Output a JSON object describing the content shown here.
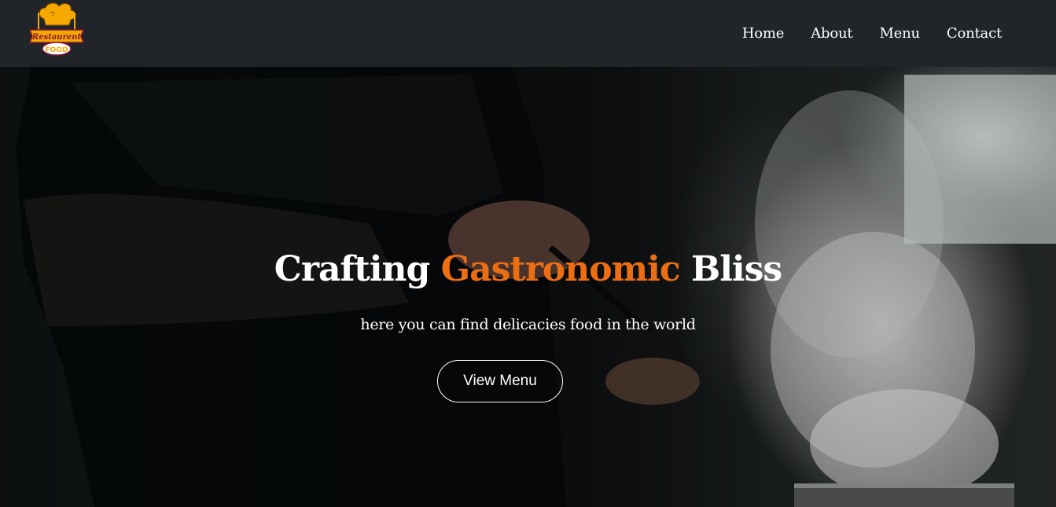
{
  "nav": {
    "logo": {
      "top_text": "Restaurent",
      "bottom_text": "FOOD",
      "icon": "chef-hat-logo"
    },
    "links": [
      {
        "label": "Home"
      },
      {
        "label": "About"
      },
      {
        "label": "Menu"
      },
      {
        "label": "Contact"
      }
    ]
  },
  "hero": {
    "title_part1": "Crafting",
    "title_accent": "Gastronomic",
    "title_part2": "Bliss",
    "subtitle": "here you can find delicacies food in the world",
    "button_label": "View Menu"
  },
  "colors": {
    "navbar_bg": "#212529",
    "accent": "#ec6e13",
    "text": "#ffffff",
    "logo_yellow": "#f5a800",
    "logo_maroon": "#8b1538"
  }
}
